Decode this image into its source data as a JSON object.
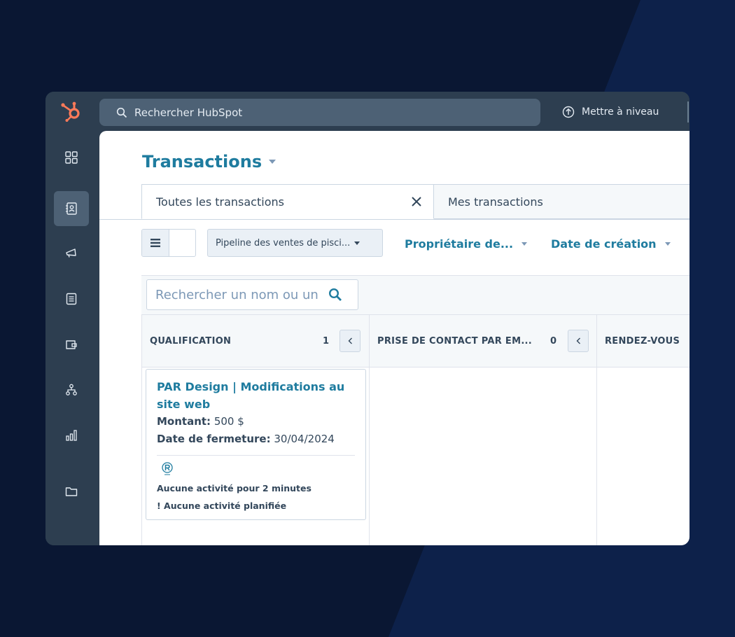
{
  "topbar": {
    "search_placeholder": "Rechercher HubSpot",
    "upgrade_label": "Mettre à niveau"
  },
  "sidebar": {
    "items": [
      {
        "icon": "grid-icon"
      },
      {
        "icon": "contacts-icon",
        "active": true
      },
      {
        "icon": "megaphone-icon"
      },
      {
        "icon": "document-icon"
      },
      {
        "icon": "wallet-icon"
      },
      {
        "icon": "network-icon"
      },
      {
        "icon": "bar-chart-icon"
      },
      {
        "icon": "folder-icon"
      }
    ]
  },
  "page": {
    "title": "Transactions"
  },
  "tabs": [
    {
      "label": "Toutes les transactions",
      "active": true
    },
    {
      "label": "Mes transactions",
      "active": false
    }
  ],
  "toolbar": {
    "pipeline_value": "Pipeline des ventes de pisci...",
    "filter_owner": "Propriétaire de...",
    "filter_created": "Date de création"
  },
  "board": {
    "search_placeholder": "Rechercher un nom ou une description",
    "columns": [
      {
        "title": "QUALIFICATION",
        "count": "1"
      },
      {
        "title": "PRISE DE CONTACT PAR EM...",
        "count": "0"
      },
      {
        "title": "RENDEZ-VOUS"
      }
    ],
    "card": {
      "title_line1": "PAR Design | Modifications au",
      "title_line2": "site web",
      "amount_label": "Montant:",
      "amount_value": "500 $",
      "close_label": "Date de fermeture:",
      "close_value": "30/04/2024",
      "activity": "Aucune activité pour 2 minutes",
      "scheduled": "! Aucune activité planifiée"
    }
  },
  "colors": {
    "brand_orange": "#ff7a59",
    "link_teal": "#1f7c9f",
    "nav_dark": "#2d3e50",
    "background": "#0a1733"
  }
}
